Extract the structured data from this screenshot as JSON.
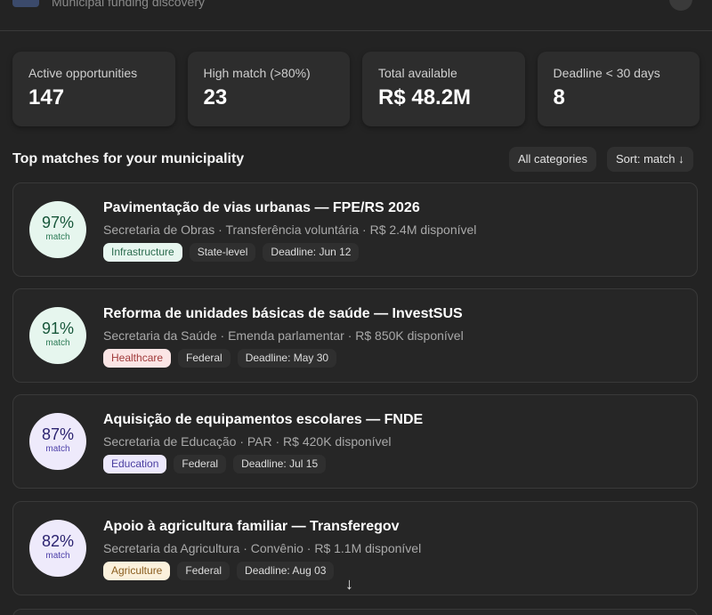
{
  "header": {
    "subtitle": "Municipal funding discovery"
  },
  "stats": [
    {
      "label": "Active opportunities",
      "value": "147"
    },
    {
      "label": "High match (>80%)",
      "value": "23"
    },
    {
      "label": "Total available",
      "value": "R$ 48.2M"
    },
    {
      "label": "Deadline < 30 days",
      "value": "8"
    }
  ],
  "section": {
    "title": "Top matches for your municipality",
    "filter_label": "All categories",
    "sort_label": "Sort: match ↓"
  },
  "cards": [
    {
      "match": "97%",
      "match_label": "match",
      "ring_color": "#e6f6ee",
      "title": "Pavimentação de vias urbanas — FPE/RS 2026",
      "meta": "Secretaria de Obras · Transferência voluntária · R$ 2.4M disponível",
      "category": "Infrastructure",
      "category_color": "#e7f6ef",
      "level": "State-level",
      "deadline": "Deadline: Jun 12"
    },
    {
      "match": "91%",
      "match_label": "match",
      "ring_color": "#e6f6ee",
      "title": "Reforma de unidades básicas de saúde — InvestSUS",
      "meta": "Secretaria da Saúde · Emenda parlamentar · R$ 850K disponível",
      "category": "Healthcare",
      "category_color": "#fbe5e5",
      "level": "Federal",
      "deadline": "Deadline: May 30"
    },
    {
      "match": "87%",
      "match_label": "match",
      "ring_color": "#eeeafb",
      "title": "Aquisição de equipamentos escolares — FNDE",
      "meta": "Secretaria de Educação · PAR · R$ 420K disponível",
      "category": "Education",
      "category_color": "#ece8fb",
      "level": "Federal",
      "deadline": "Deadline: Jul 15"
    },
    {
      "match": "82%",
      "match_label": "match",
      "ring_color": "#eeeafb",
      "title": "Apoio à agricultura familiar — Transferegov",
      "meta": "Secretaria da Agricultura · Convênio · R$ 1.1M disponível",
      "category": "Agriculture",
      "category_color": "#fbf1dc",
      "level": "Federal",
      "deadline": "Deadline: Aug 03"
    }
  ],
  "scroll_hint": "↓"
}
